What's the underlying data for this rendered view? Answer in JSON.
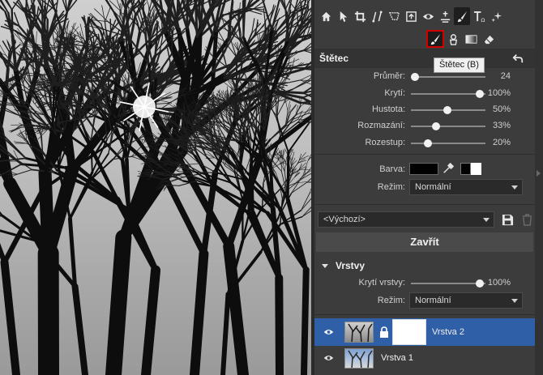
{
  "toolbar": {
    "icons": [
      "home-icon",
      "pointer-icon",
      "crop-icon",
      "transform-icon",
      "select-icon",
      "frame-icon",
      "eye-icon",
      "exposure-icon",
      "brush-icon",
      "text-icon",
      "effects-icon"
    ],
    "active_tool": "brush-icon"
  },
  "brush_tools": {
    "icons": [
      "brush-icon",
      "stamp-icon",
      "gradient-icon",
      "eraser-icon"
    ],
    "selected": "brush-icon",
    "tooltip": "Štětec (B)"
  },
  "brush_panel": {
    "title": "Štětec",
    "sliders": [
      {
        "label": "Průměr:",
        "value": "24",
        "fraction": 0.0
      },
      {
        "label": "Krytí:",
        "value": "100%",
        "fraction": 1.0
      },
      {
        "label": "Hustota:",
        "value": "50%",
        "fraction": 0.5
      },
      {
        "label": "Rozmazání:",
        "value": "33%",
        "fraction": 0.33
      },
      {
        "label": "Rozestup:",
        "value": "20%",
        "fraction": 0.2
      }
    ],
    "color_label": "Barva:",
    "color_value": "#000000",
    "mode_label": "Režim:",
    "mode_value": "Normální"
  },
  "preset": {
    "value": "<Výchozí>"
  },
  "close_button": "Zavřít",
  "layers": {
    "title": "Vrstvy",
    "opacity_label": "Krytí vrstvy:",
    "opacity_value": "100%",
    "opacity_fraction": 1.0,
    "mode_label": "Režim:",
    "mode_value": "Normální",
    "items": [
      {
        "name": "Vrstva 2",
        "active": true,
        "has_mask": true,
        "locked": true
      },
      {
        "name": "Vrstva 1",
        "active": false,
        "has_mask": false,
        "locked": false
      }
    ]
  },
  "colors": {
    "panel_bg": "#3c3c3c",
    "selected_layer": "#2f5fa6",
    "tool_highlight": "#d40000"
  }
}
